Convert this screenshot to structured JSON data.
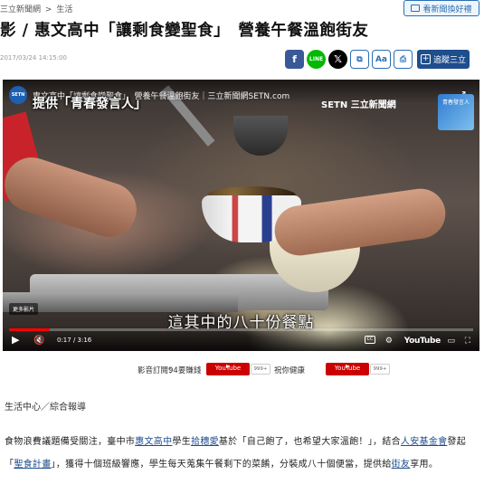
{
  "breadcrumb": {
    "home": "三立新聞網",
    "sep": ">",
    "section": "生活"
  },
  "top_link": {
    "label": "看新聞換好禮"
  },
  "headline": "影 / 惠文高中「讓剩食變聖食」　營養午餐溫飽街友",
  "meta": {
    "datetime": "2017/03/24 14:15:00"
  },
  "share": {
    "facebook": "f",
    "line": "LINE",
    "x": "𝕏",
    "link": "⧉",
    "font": "Aa",
    "print": "⎙",
    "follow": "追蹤三立"
  },
  "video": {
    "channel_logo": "SETN",
    "title": "惠文高中「讓剩食變聖食」　營養午餐溫飽街友｜三立新聞網SETN.com",
    "stripe_text": "提供「青春發言人」",
    "brand": "SETN 三立新聞網",
    "thumb_text": "青春發言人",
    "more": "更多影片",
    "subtitle": "這其中的八十份餐點",
    "time": "0:17 / 3:16",
    "progress_fraction": 0.087,
    "youtube": "YouTube"
  },
  "subscribe": {
    "label": "影音訂閱：",
    "channel1": "94要賺錢",
    "yt1": "YouTube",
    "count1": "999+",
    "channel2": "祝你健康",
    "yt2": "YouTube",
    "count2": "999+"
  },
  "byline": "生活中心／綜合報導",
  "paragraph": {
    "p1": "食物浪費議題備受關注，臺中市",
    "link1": "惠文高中",
    "p2": "學生",
    "link2": "拾穗愛",
    "p3": "基於「自己飽了，也希望大家溫飽！」，結合",
    "link3": "人安基金會",
    "p4": "發起「",
    "link4": "聖食計畫",
    "p5": "」，獲得十個班級響應，學生每天蒐集午餐剩下的菜餚，分裝成八十個便當，提供給",
    "link5": "街友",
    "p6": "享用。"
  }
}
